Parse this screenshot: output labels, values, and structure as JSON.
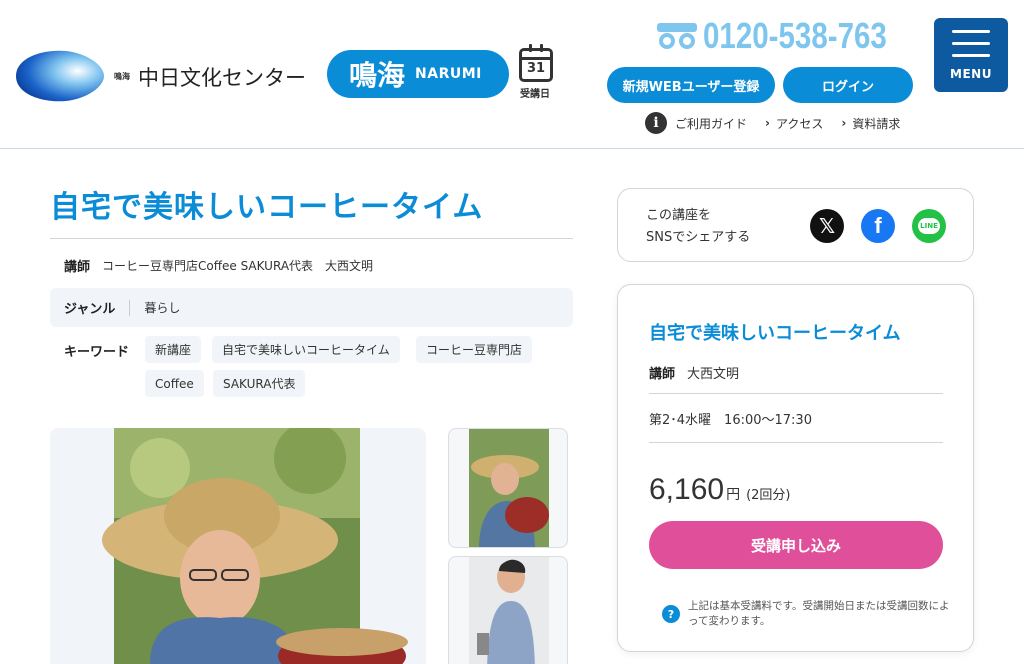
{
  "header": {
    "logo_small": "鳴海",
    "logo_text": "中日文化センター",
    "branch_kanji": "鳴海",
    "branch_roman": "NARUMI",
    "calendar_num": "31",
    "calendar_label": "受講日",
    "phone": "0120-538-763",
    "register_label": "新規WEBユーザー登録",
    "login_label": "ログイン",
    "guide_label": "ご利用ガイド",
    "access_label": "アクセス",
    "request_label": "資料請求",
    "menu_label": "MENU"
  },
  "course": {
    "title": "自宅で美味しいコーヒータイム",
    "teacher_label": "講師",
    "teacher_value": "コーヒー豆専門店Coffee SAKURA代表　大西文明",
    "genre_label": "ジャンル",
    "genre_value": "暮らし",
    "keyword_label": "キーワード",
    "keywords": [
      "新講座",
      "自宅で美味しいコーヒータイム",
      "コーヒー豆専門店",
      "Coffee",
      "SAKURA代表"
    ]
  },
  "sns": {
    "text_line1": "この講座を",
    "text_line2": "SNSでシェアする",
    "x_glyph": "𝕏",
    "fb_glyph": "f",
    "line_glyph": "LINE"
  },
  "card": {
    "title": "自宅で美味しいコーヒータイム",
    "teacher_label": "講師",
    "teacher_name": "大西文明",
    "schedule": "第2･4水曜　16:00〜17:30",
    "price": "6,160",
    "price_unit": "円",
    "price_note": "(2回分)",
    "apply_label": "受講申し込み",
    "note": "上記は基本受講料です。受講開始日または受講回数によって変わります。"
  },
  "icons": {
    "info": "i",
    "chevron": "›",
    "question": "?"
  },
  "colors": {
    "accent": "#0b8cd7",
    "phone": "#7ec6ee",
    "menu_bg": "#0d5aa0",
    "apply": "#e0509a"
  }
}
